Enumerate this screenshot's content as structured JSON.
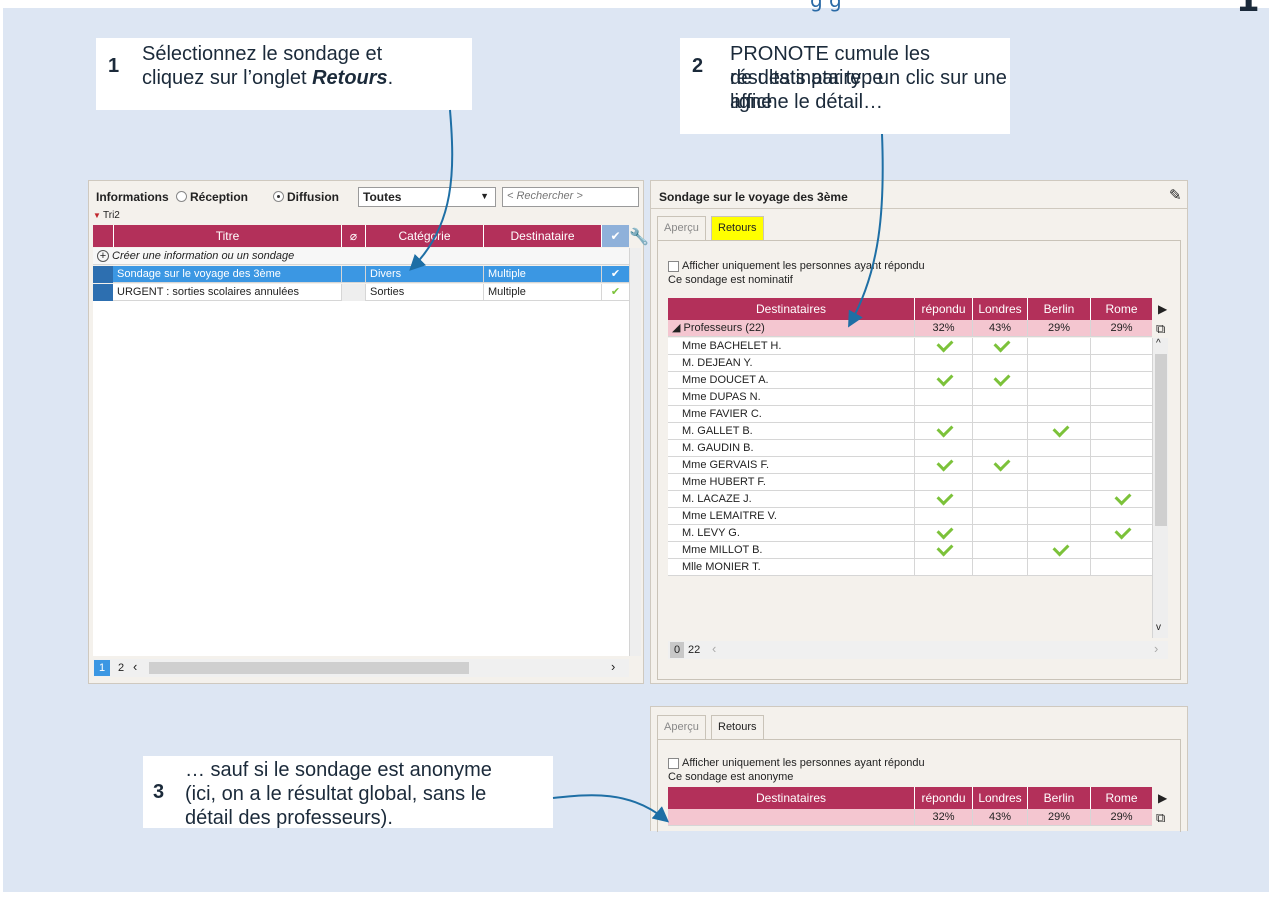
{
  "callouts": [
    {
      "num": "1",
      "text": [
        "Sélectionnez le sondage et",
        "cliquez sur l’onglet "
      ],
      "emph": "Retours",
      "emph_tail": "."
    },
    {
      "num": "2",
      "text": [
        "PRONOTE cumule les résultats par type",
        "de destinataire : un clic sur une ligne",
        "affiche le détail…"
      ]
    },
    {
      "num": "3",
      "text": [
        "… sauf si le sondage est anonyme",
        "(ici, on a le résultat global, sans le",
        "détail des professeurs)."
      ]
    }
  ],
  "left": {
    "informations_label": "Informations",
    "reception_label": "Réception",
    "diffusion_label": "Diffusion",
    "filter_value": "Toutes",
    "search_placeholder": "< Rechercher >",
    "sort_label": "Tri2",
    "columns": [
      "Titre",
      "Catégorie",
      "Destinataire"
    ],
    "create_label": "Créer une information ou un sondage",
    "rows": [
      {
        "title": "Sondage sur le voyage des 3ème",
        "category": "Divers",
        "dest": "Multiple",
        "selected": true
      },
      {
        "title": "URGENT : sorties scolaires annulées",
        "category": "Sorties",
        "dest": "Multiple",
        "selected": false
      }
    ],
    "pages": [
      "1",
      "2"
    ]
  },
  "right": {
    "title": "Sondage sur le voyage des 3ème",
    "tabs": [
      "Aperçu",
      "Retours"
    ],
    "filter_label": "Afficher uniquement les personnes ayant répondu",
    "nominatif": "Ce sondage est nominatif",
    "columns": [
      "Destinataires",
      "répondu",
      "Londres",
      "Berlin",
      "Rome"
    ],
    "group": {
      "label": "Professeurs (22)",
      "repondu": "32%",
      "londres": "43%",
      "berlin": "29%",
      "rome": "29%"
    },
    "people": [
      {
        "name": "Mme BACHELET H.",
        "repondu": true,
        "londres": true,
        "berlin": false,
        "rome": false
      },
      {
        "name": "M. DEJEAN Y.",
        "repondu": false,
        "londres": false,
        "berlin": false,
        "rome": false
      },
      {
        "name": "Mme DOUCET A.",
        "repondu": true,
        "londres": true,
        "berlin": false,
        "rome": false
      },
      {
        "name": "Mme DUPAS N.",
        "repondu": false,
        "londres": false,
        "berlin": false,
        "rome": false
      },
      {
        "name": "Mme FAVIER C.",
        "repondu": false,
        "londres": false,
        "berlin": false,
        "rome": false
      },
      {
        "name": "M. GALLET B.",
        "repondu": true,
        "londres": false,
        "berlin": true,
        "rome": false
      },
      {
        "name": "M. GAUDIN B.",
        "repondu": false,
        "londres": false,
        "berlin": false,
        "rome": false
      },
      {
        "name": "Mme GERVAIS F.",
        "repondu": true,
        "londres": true,
        "berlin": false,
        "rome": false
      },
      {
        "name": "Mme HUBERT F.",
        "repondu": false,
        "londres": false,
        "berlin": false,
        "rome": false
      },
      {
        "name": "M. LACAZE J.",
        "repondu": true,
        "londres": false,
        "berlin": false,
        "rome": true
      },
      {
        "name": "Mme LEMAITRE V.",
        "repondu": false,
        "londres": false,
        "berlin": false,
        "rome": false
      },
      {
        "name": "M. LEVY G.",
        "repondu": true,
        "londres": false,
        "berlin": false,
        "rome": true
      },
      {
        "name": "Mme MILLOT B.",
        "repondu": true,
        "londres": false,
        "berlin": true,
        "rome": false
      },
      {
        "name": "Mlle MONIER T.",
        "repondu": false,
        "londres": false,
        "berlin": false,
        "rome": false
      }
    ],
    "pages": [
      "0",
      "22"
    ]
  },
  "bottom": {
    "tabs": [
      "Aperçu",
      "Retours"
    ],
    "filter_label": "Afficher uniquement les personnes ayant répondu",
    "anonyme": "Ce sondage est anonyme",
    "columns": [
      "Destinataires",
      "répondu",
      "Londres",
      "Berlin",
      "Rome"
    ],
    "values": [
      "32%",
      "43%",
      "29%",
      "29%"
    ]
  },
  "colors": {
    "header": "#b3305a",
    "selected": "#3b97e3",
    "group_row": "#f4c6d0",
    "tab_active": "#ffff00",
    "arrow": "#1e6fa5"
  }
}
